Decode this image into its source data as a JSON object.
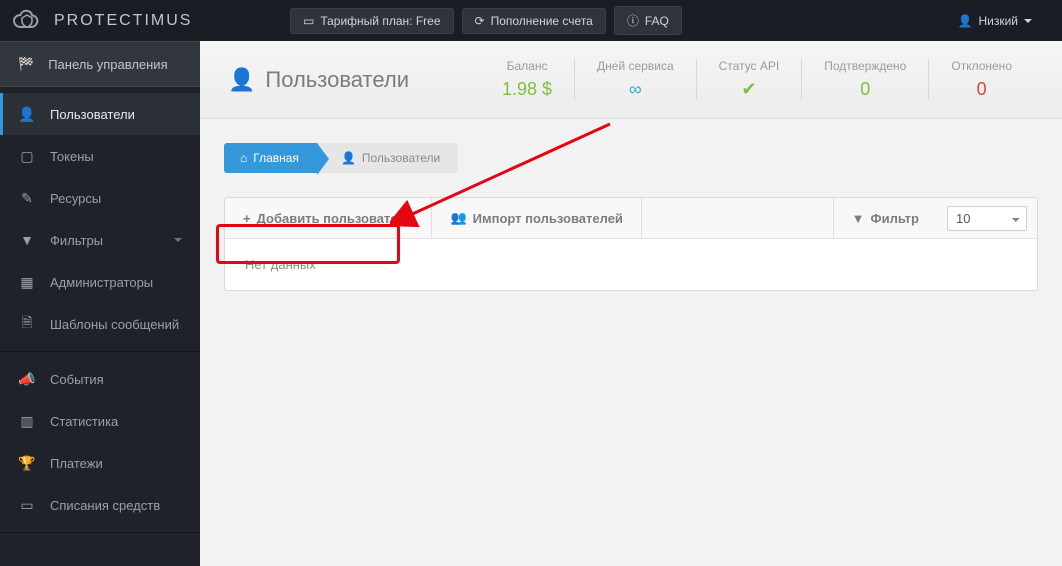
{
  "brand": "PROTECTIMUS",
  "topbar": {
    "plan_prefix": "Тарифный план:",
    "plan_value": "Free",
    "topup": "Пополнение счета",
    "faq": "FAQ",
    "user": "Низкий"
  },
  "sidebar": {
    "dashboard": "Панель управления",
    "users": "Пользователи",
    "tokens": "Токены",
    "resources": "Ресурсы",
    "filters": "Фильтры",
    "admins": "Администраторы",
    "templates": "Шаблоны сообщений",
    "events": "События",
    "stats": "Статистика",
    "payments": "Платежи",
    "debits": "Списания средств"
  },
  "page": {
    "title": "Пользователи"
  },
  "stats": {
    "balance_lbl": "Баланс",
    "balance_val": "1.98 $",
    "days_lbl": "Дней сервиса",
    "days_val": "∞",
    "api_lbl": "Статус API",
    "api_val": "✔",
    "confirmed_lbl": "Подтверждено",
    "confirmed_val": "0",
    "rejected_lbl": "Отклонено",
    "rejected_val": "0"
  },
  "breadcrumb": {
    "home": "Главная",
    "current": "Пользователи"
  },
  "toolbar": {
    "add_user": "Добавить пользователя",
    "import_users": "Импорт пользователей",
    "filter": "Фильтр",
    "page_size": "10"
  },
  "table": {
    "empty": "Нет данных"
  }
}
